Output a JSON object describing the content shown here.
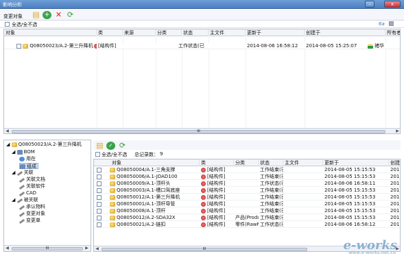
{
  "window": {
    "title": "影响分析"
  },
  "toolbar": {
    "change_object_label": "变更对象",
    "icons": [
      "folder-icon",
      "add-icon",
      "delete-icon",
      "refresh-icon"
    ]
  },
  "top_panel": {
    "select_all_label": "全选/全不选",
    "columns": [
      "对象",
      "类",
      "来源",
      "分类",
      "状态",
      "主文件",
      "更新于",
      "创建于",
      "所有者"
    ],
    "rows": [
      {
        "object": "Q08050023/A.2-第三升降机",
        "class": "[结构件]",
        "source": "",
        "category": "",
        "status": "工作状态(已",
        "main_file": "",
        "updated": "2014-08-06 16:58:12",
        "created": "2014-08-05 15:25:07",
        "owner": "褚华"
      }
    ],
    "scroll_mid": "III"
  },
  "tree": {
    "root": "Q08050023/A.2-第三升降机",
    "items": [
      {
        "label": "BOM",
        "icon": "bom-icon",
        "level": 1
      },
      {
        "label": "用在",
        "icon": "used-in-icon",
        "level": 2
      },
      {
        "label": "组成",
        "icon": "composition-icon",
        "level": 2,
        "selected": true
      },
      {
        "label": "关联",
        "icon": "link-icon",
        "level": 1
      },
      {
        "label": "关联文档",
        "icon": "link-icon",
        "level": 2
      },
      {
        "label": "关联软件",
        "icon": "link-icon",
        "level": 2
      },
      {
        "label": "CAD",
        "icon": "link-icon",
        "level": 2
      },
      {
        "label": "被关联",
        "icon": "link-icon",
        "level": 1
      },
      {
        "label": "承认物料",
        "icon": "link-icon",
        "level": 2
      },
      {
        "label": "变更对象",
        "icon": "link-icon",
        "level": 2
      },
      {
        "label": "变更单",
        "icon": "link-icon",
        "level": 2
      }
    ],
    "scroll_mid": "III"
  },
  "bottom_panel": {
    "select_all_label": "全选/全不选",
    "total_label": "总记录数：",
    "total_value": "9",
    "columns": [
      "对象",
      "类",
      "分类",
      "状态",
      "主文件",
      "更新于",
      "创建"
    ],
    "rows": [
      {
        "object": "Q08050004/A.1-三角支撑",
        "class": "[结构件]",
        "category": "",
        "status": "工作结束(已",
        "main_file": "",
        "updated": "2014-08-05 15:15:53",
        "created": "201"
      },
      {
        "object": "Q08050006/A.1-JDAD100",
        "class": "[结构件]",
        "category": "",
        "status": "工作结束(已",
        "main_file": "",
        "updated": "2014-08-05 15:15:53",
        "created": "201"
      },
      {
        "object": "Q08050009/A.1-顶杆头",
        "class": "[结构件]",
        "category": "",
        "status": "工作状态(已",
        "main_file": "",
        "updated": "2014-08-06 16:58:11",
        "created": "201"
      },
      {
        "object": "Q08050003/A.1-槽口驾底座",
        "class": "[结构件]",
        "category": "",
        "status": "工作结束(已",
        "main_file": "",
        "updated": "2014-08-05 15:15:53",
        "created": "201"
      },
      {
        "object": "Q08050012/A.1-第三升降机",
        "class": "[结构件]",
        "category": "",
        "status": "工作结束(已",
        "main_file": "",
        "updated": "2014-08-05 15:15:53",
        "created": "201"
      },
      {
        "object": "Q08050001/A.1-顶杆导管",
        "class": "[结构件]",
        "category": "",
        "status": "工作结束(已",
        "main_file": "",
        "updated": "2014-08-05 15:15:53",
        "created": "201"
      },
      {
        "object": "Q08050008/A.1-顶杆",
        "class": "[结构件]",
        "category": "",
        "status": "工作结束(已",
        "main_file": "",
        "updated": "2014-08-05 15:15:53",
        "created": "201"
      },
      {
        "object": "Q08050012/A.2-SDA32X",
        "class": "[结构件]",
        "category": "产品(Produ",
        "status": "工作结束(已",
        "main_file": "",
        "updated": "2014-08-05 15:15:53",
        "created": "201"
      },
      {
        "object": "Q08050021/A.2-链扣",
        "class": "[结构件]",
        "category": "零件(RawM",
        "status": "工作状态(已",
        "main_file": "",
        "updated": "2014-08-06 16:58:12",
        "created": "201"
      }
    ],
    "scroll_mid": "III"
  },
  "watermark": {
    "brand": "e-works",
    "sub": "www.e-works.net.cn"
  }
}
